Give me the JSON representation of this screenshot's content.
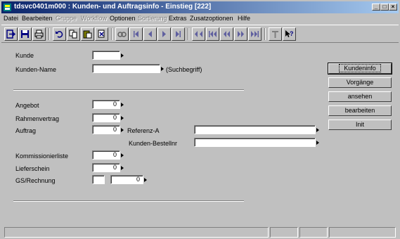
{
  "window": {
    "title": "tdsvc0401m000 : Kunden- und Auftragsinfo - Einstieg [222]",
    "controls": {
      "minimize": "_",
      "maximize": "□",
      "close": "×"
    }
  },
  "menu": [
    {
      "label": "Datei",
      "enabled": true
    },
    {
      "label": "Bearbeiten",
      "enabled": true
    },
    {
      "label": "Gruppe",
      "enabled": false
    },
    {
      "label": "Workflow",
      "enabled": false
    },
    {
      "label": "Optionen",
      "enabled": true
    },
    {
      "label": "Sortierung",
      "enabled": false
    },
    {
      "label": "Extras",
      "enabled": true
    },
    {
      "label": "Zusatzoptionen",
      "enabled": true
    },
    {
      "label": "Hilfe",
      "enabled": true
    }
  ],
  "toolbar": {
    "icons": [
      "exit-icon",
      "save-icon",
      "print-icon",
      "undo-icon",
      "copy-icon",
      "paste-icon",
      "delete-icon",
      "find-icon",
      "first-record-icon",
      "previous-record-icon",
      "next-record-icon",
      "last-record-icon",
      "first-page-icon",
      "previous-page-icon",
      "next-page-icon",
      "last-page-icon",
      "text-icon",
      "context-help-icon"
    ]
  },
  "form": {
    "kunde": {
      "label": "Kunde",
      "value": ""
    },
    "kunden_name": {
      "label": "Kunden-Name",
      "value": "",
      "hint": "(Suchbegriff)"
    },
    "angebot": {
      "label": "Angebot",
      "value": "0"
    },
    "rahmenvertrag": {
      "label": "Rahmenvertrag",
      "value": "0"
    },
    "auftrag": {
      "label": "Auftrag",
      "value": "0"
    },
    "referenz_a": {
      "label": "Referenz-A",
      "value": ""
    },
    "kunden_bestellnr": {
      "label": "Kunden-Bestellnr",
      "value": ""
    },
    "kommissionierliste": {
      "label": "Kommissionierliste",
      "value": "0"
    },
    "lieferschein": {
      "label": "Lieferschein",
      "value": "0"
    },
    "gs_rechnung": {
      "label": "GS/Rechnung",
      "prefix": "",
      "value": "0"
    }
  },
  "buttons": {
    "kundeninfo": "Kundeninfo",
    "vorgaenge": "Vorgänge",
    "ansehen": "ansehen",
    "bearbeiten": "bearbeiten",
    "init": "Init"
  },
  "statusbar": [
    "",
    "",
    "",
    ""
  ]
}
